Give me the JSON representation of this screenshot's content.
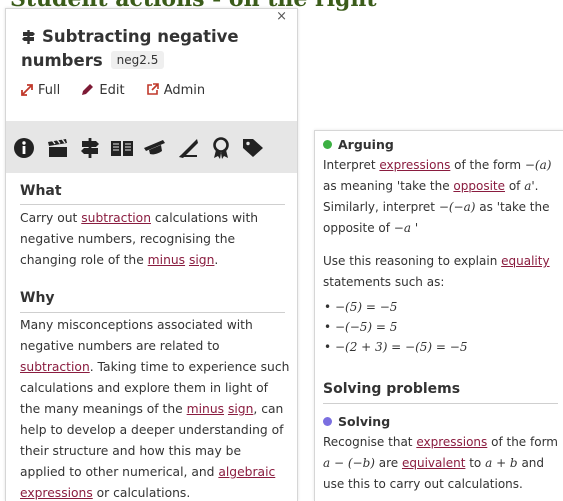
{
  "page": {
    "heading": "Student actions - on the right"
  },
  "left_panel": {
    "title_line1": "Subtracting negative",
    "title_line2": "numbers",
    "code": "neg2.5",
    "close": "×",
    "actions": [
      {
        "label": "Full",
        "icon": "expand-icon"
      },
      {
        "label": "Edit",
        "icon": "pencil-icon"
      },
      {
        "label": "Admin",
        "icon": "external-link-icon"
      }
    ],
    "tabs": [
      "info-icon",
      "clapperboard-icon",
      "signpost-icon",
      "book-icon",
      "graduation-cap-icon",
      "pen-ruler-icon",
      "award-icon",
      "tag-icon"
    ],
    "what": {
      "heading": "What",
      "line1_pre": "Carry out ",
      "line1_link": "subtraction",
      "line1_post": " calculations with",
      "line2": "negative numbers, recognising the",
      "line3_pre": "changing role of the ",
      "line3_link1": "minus",
      "line3_link2": "sign",
      "line3_post": "."
    },
    "why": {
      "heading": "Why",
      "line1": "Many misconceptions associated with",
      "line2": "negative numbers are related to",
      "line3_link": "subtraction",
      "line3_post": ". Taking time to experience such",
      "line4": "calculations and explore them in light of",
      "line5_pre": "the many meanings of the ",
      "line5_link1": "minus",
      "line5_link2": "sign",
      "line5_post": ", can",
      "line6": "help to develop a deeper understanding of",
      "line7": "their structure and how this may be",
      "line8_pre": "applied to other numerical, and ",
      "line8_link": "algebraic",
      "line9_link": "expressions",
      "line9_post": " or calculations."
    }
  },
  "right_panel": {
    "arguing": {
      "label": "Arguing",
      "color": "#3cb043",
      "l1_pre": "Interpret ",
      "l1_link": "expressions",
      "l1_mid": " of the form ",
      "l1_math": "−(a)",
      "l2_pre": "as meaning 'take the ",
      "l2_link": "opposite",
      "l2_mid": " of ",
      "l2_math": "a",
      "l2_post": "'.",
      "l3_pre": "Similarly, interpret ",
      "l3_math": "−(−a)",
      "l3_post": " as 'take the",
      "l4_pre": "opposite of ",
      "l4_math": "−a",
      "l4_post": " '",
      "l5_pre": "Use this reasoning to explain ",
      "l5_link": "equality",
      "l6": "statements such as:",
      "bullets": [
        "−(5) = −5",
        "−(−5) = 5",
        "−(2 + 3) = −(5) = −5"
      ]
    },
    "solving_problems": {
      "heading": "Solving problems",
      "label": "Solving",
      "color": "#7b6fe0",
      "l1_pre": "Recognise that ",
      "l1_link": "expressions",
      "l1_post": " of the form",
      "l2_math1": "a − (−b)",
      "l2_mid1": " are ",
      "l2_link": "equivalent",
      "l2_mid2": " to ",
      "l2_math2": "a + b",
      "l2_post": " and",
      "l3": "use this to carry out calculations."
    }
  }
}
